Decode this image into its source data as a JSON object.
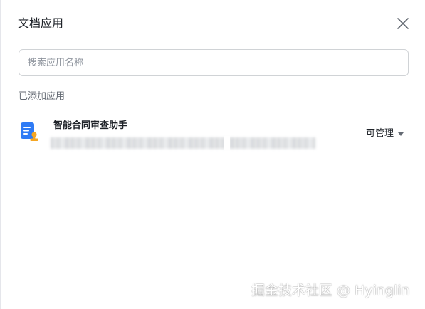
{
  "dialog": {
    "title": "文档应用",
    "close_icon": "close-icon"
  },
  "search": {
    "placeholder": "搜索应用名称",
    "value": ""
  },
  "section": {
    "added_label": "已添加应用"
  },
  "apps": [
    {
      "icon": "document-review-icon",
      "name": "智能合同审查助手",
      "description": "",
      "permission": "可管理",
      "permission_icon": "caret-down-icon"
    }
  ],
  "watermark": {
    "text": "掘金技术社区 @ Hyinglin"
  },
  "colors": {
    "icon_blue": "#2f7bf5",
    "icon_orange": "#f5a623",
    "text_primary": "#1f2329",
    "text_secondary": "#646a73",
    "border": "#d0d3d6"
  }
}
